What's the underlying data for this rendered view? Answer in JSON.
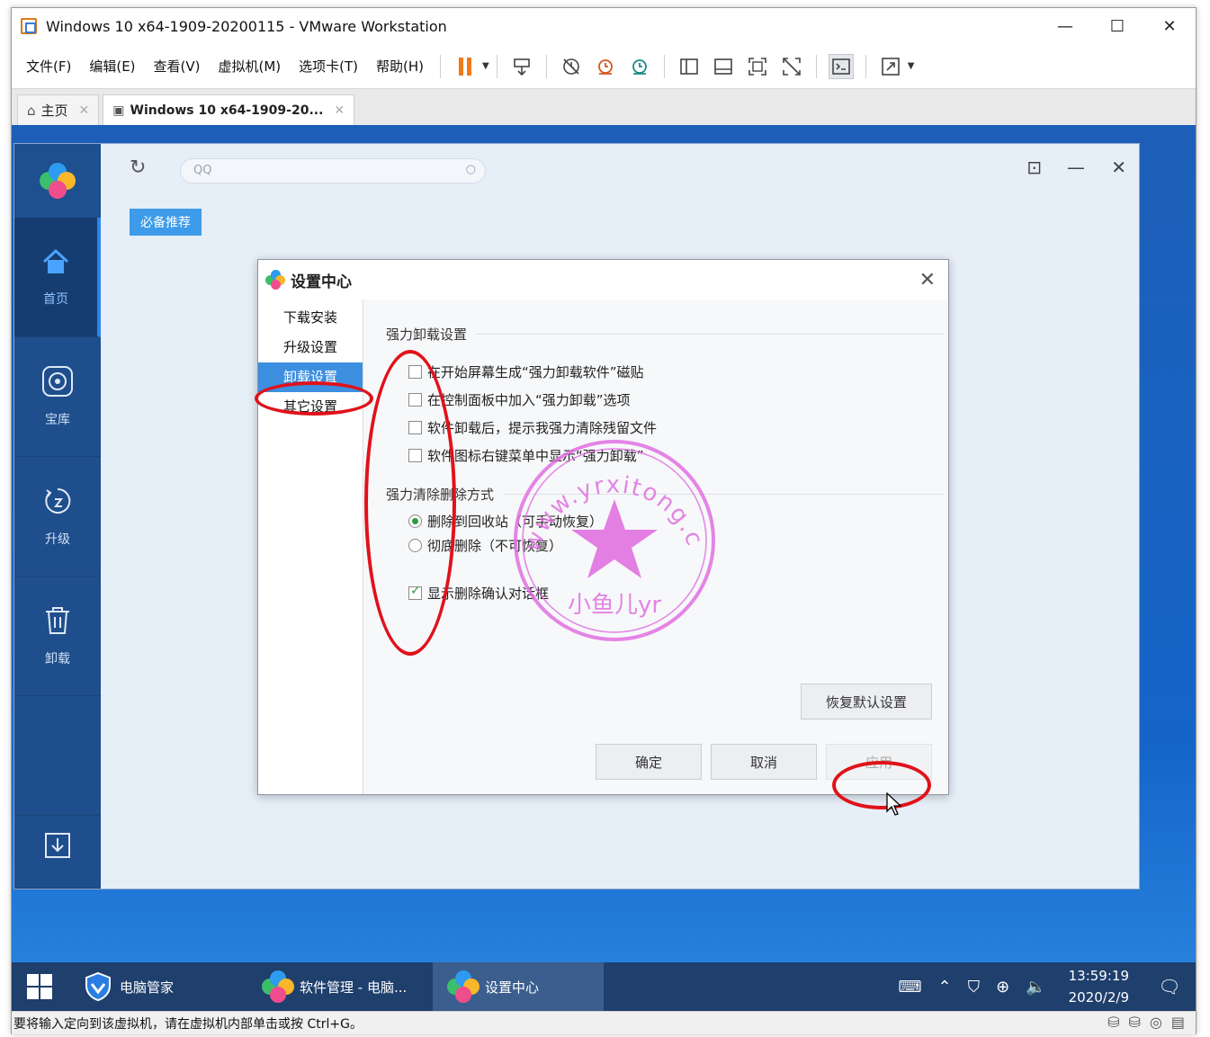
{
  "vmware": {
    "title": "Windows 10 x64-1909-20200115 - VMware Workstation",
    "menus": [
      "文件(F)",
      "编辑(E)",
      "查看(V)",
      "虚拟机(M)",
      "选项卡(T)",
      "帮助(H)"
    ],
    "tabs": [
      {
        "label": "主页",
        "icon": "home-icon"
      },
      {
        "label": "Windows 10 x64-1909-20...",
        "icon": "vm-icon"
      }
    ],
    "status_text": "要将输入定向到该虚拟机，请在虚拟机内部单击或按 Ctrl+G。"
  },
  "software_manager": {
    "search_placeholder": "QQ",
    "tag": "必备推荐",
    "nav": [
      {
        "label": "首页",
        "icon": "home-icon",
        "active": true
      },
      {
        "label": "宝库",
        "icon": "disc-icon",
        "active": false
      },
      {
        "label": "升级",
        "icon": "upgrade-icon",
        "active": false
      },
      {
        "label": "卸载",
        "icon": "trash-icon",
        "active": false
      }
    ]
  },
  "settings_dialog": {
    "title": "设置中心",
    "nav": [
      "下载安装",
      "升级设置",
      "卸载设置",
      "其它设置"
    ],
    "selected_nav": "卸载设置",
    "group1_title": "强力卸载设置",
    "group1_options": [
      {
        "label": "在开始屏幕生成“强力卸载软件”磁贴",
        "checked": false
      },
      {
        "label": "在控制面板中加入“强力卸载”选项",
        "checked": false
      },
      {
        "label": "软件卸载后，提示我强力清除残留文件",
        "checked": false
      },
      {
        "label": "软件图标右键菜单中显示“强力卸载”",
        "checked": false
      }
    ],
    "group2_title": "强力清除删除方式",
    "group2_options": [
      {
        "label": "删除到回收站（可手动恢复）",
        "selected": true
      },
      {
        "label": "彻底删除（不可恢复）",
        "selected": false
      }
    ],
    "confirm_option": {
      "label": "显示删除确认对话框",
      "checked": true
    },
    "restore_button": "恢复默认设置",
    "ok_button": "确定",
    "cancel_button": "取消",
    "apply_button": "应用"
  },
  "watermark": {
    "url_text": "www.yrxitong.com",
    "name_text": "小鱼儿yr",
    "color": "#e070e0"
  },
  "taskbar": {
    "apps": [
      {
        "label": "电脑管家",
        "active": false
      },
      {
        "label": "软件管理 - 电脑...",
        "active": false
      },
      {
        "label": "设置中心",
        "active": true
      }
    ],
    "time": "13:59:19",
    "date": "2020/2/9"
  },
  "colors": {
    "annotation_red": "#e0121a",
    "sidebar": "#1f4e8c",
    "accent": "#3d8fe0"
  }
}
